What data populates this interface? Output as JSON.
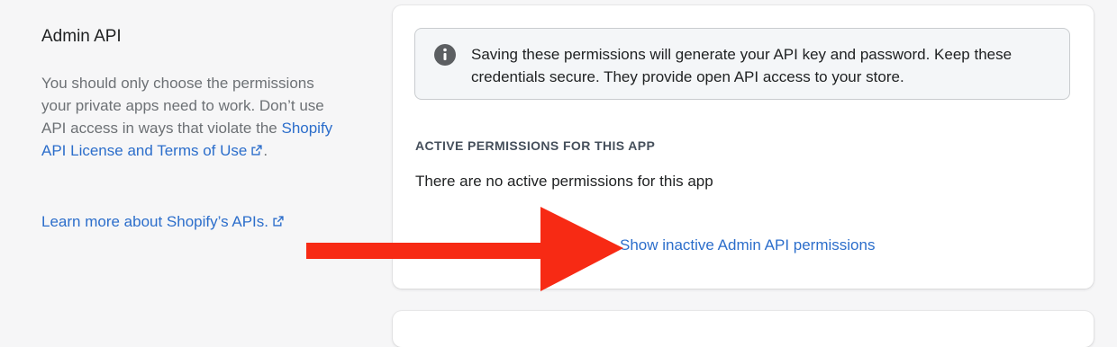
{
  "left_panel": {
    "title": "Admin API",
    "description_part1": "You should only choose the permissions your private apps need to work. Don’t use API access in ways that violate the",
    "license_link": "Shopify API License and Terms of Use",
    "description_end": ".",
    "learn_more_link": "Learn more about Shopify’s APIs."
  },
  "banner": {
    "icon": "info-icon",
    "text": "Saving these permissions will generate your API key and password. Keep these credentials secure. They provide open API access to your store."
  },
  "permissions": {
    "heading": "ACTIVE PERMISSIONS FOR THIS APP",
    "empty_text": "There are no active permissions for this app",
    "show_inactive_link": "Show inactive Admin API permissions"
  },
  "colors": {
    "link": "#2c6ecb",
    "annotation_arrow": "#f72a14",
    "background": "#f6f6f7"
  }
}
